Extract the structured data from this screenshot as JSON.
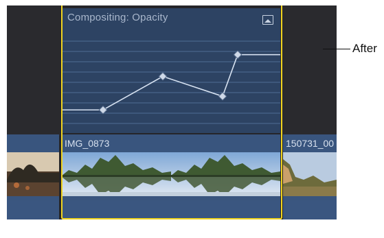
{
  "animation_editor": {
    "title": "Compositing: Opacity",
    "keyframes": [
      0.18,
      0.55,
      0.33,
      0.79
    ],
    "line_color": "#d7e2f1",
    "grid_color": "#4e6d96"
  },
  "clips": {
    "left": {
      "name": ""
    },
    "selected": {
      "name": "IMG_0873"
    },
    "right": {
      "name": "150731_00"
    }
  },
  "callout": {
    "label": "After"
  },
  "colors": {
    "selection": "#f2d51f",
    "clip": "#39557e",
    "editor": "#2d4363"
  }
}
